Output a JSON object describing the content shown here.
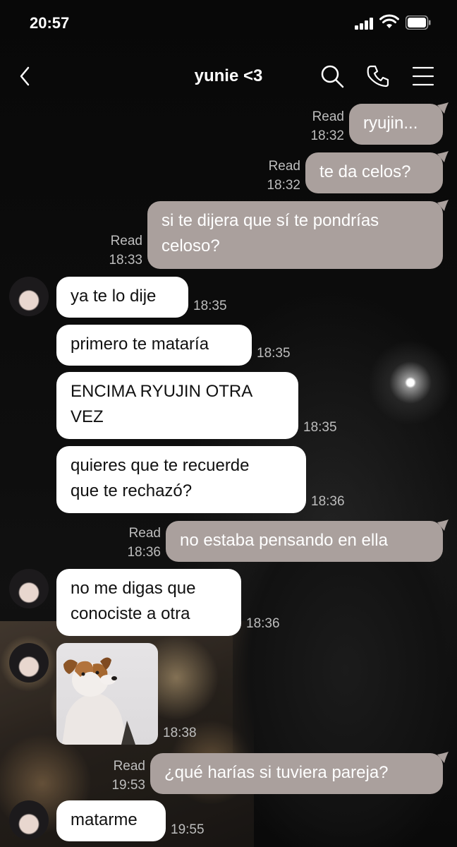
{
  "status": {
    "time": "20:57"
  },
  "header": {
    "title": "yunie <3"
  },
  "icons": {
    "back": "chevron-left-icon",
    "search": "search-icon",
    "call": "phone-icon",
    "menu": "menu-icon"
  },
  "colors": {
    "outgoing_bubble": "#aaa09d",
    "incoming_bubble": "#ffffff",
    "meta_text": "#bdbdbd"
  },
  "messages": [
    {
      "dir": "out",
      "text": "ryujin...",
      "read": "Read",
      "time": "18:32"
    },
    {
      "dir": "out",
      "text": "te da celos?",
      "read": "Read",
      "time": "18:32"
    },
    {
      "dir": "out",
      "line1": "si te dijera que sí te pondrías",
      "line2": "celoso?",
      "read": "Read",
      "time": "18:33"
    },
    {
      "dir": "in",
      "text": "ya te lo dije",
      "time": "18:35"
    },
    {
      "dir": "in",
      "text": "primero te mataría",
      "time": "18:35"
    },
    {
      "dir": "in",
      "line1": "ENCIMA RYUJIN OTRA",
      "line2": "VEZ",
      "time": "18:35"
    },
    {
      "dir": "in",
      "line1": "quieres que te recuerde",
      "line2": "que te rechazó?",
      "time": "18:36"
    },
    {
      "dir": "out",
      "text": "no estaba pensando en ella",
      "read": "Read",
      "time": "18:36"
    },
    {
      "dir": "in",
      "line1": "no me digas que",
      "line2": "conociste a otra",
      "time": "18:36"
    },
    {
      "dir": "in",
      "type": "image",
      "image": "dog-photo",
      "time": "18:38"
    },
    {
      "dir": "out",
      "text": "¿qué harías si tuviera pareja?",
      "read": "Read",
      "time": "19:53"
    },
    {
      "dir": "in",
      "text": "matarme",
      "time": "19:55"
    }
  ]
}
